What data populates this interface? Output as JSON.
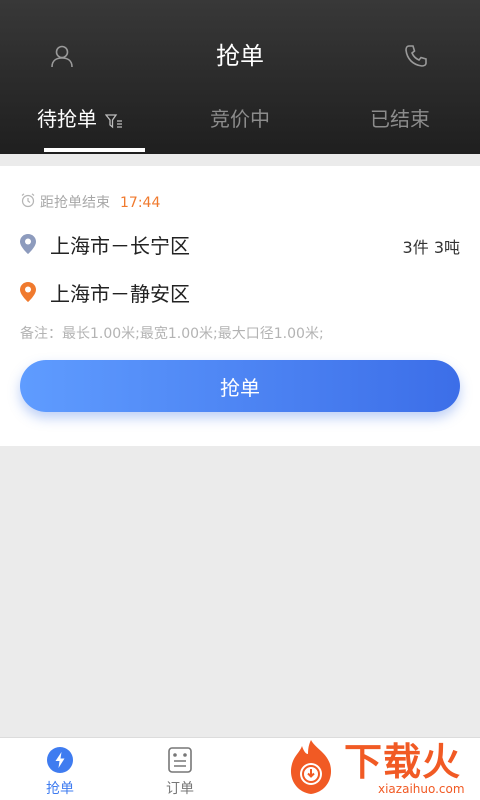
{
  "header": {
    "title": "抢单",
    "left_icon": "user-icon",
    "right_icon": "phone-icon"
  },
  "tabs": [
    {
      "label": "待抢单",
      "active": true,
      "icon": "filter-icon"
    },
    {
      "label": "竞价中",
      "active": false
    },
    {
      "label": "已结束",
      "active": false
    }
  ],
  "order": {
    "countdown_label": "距抢单结束",
    "countdown_time": "17:44",
    "from": "上海市－长宁区",
    "to": "上海市－静安区",
    "quantity": "3件 3吨",
    "remark": "备注：最长1.00米;最宽1.00米;最大口径1.00米;",
    "grab_button": "抢单"
  },
  "bottom_nav": [
    {
      "label": "抢单",
      "icon": "lightning-icon",
      "active": true
    },
    {
      "label": "订单",
      "icon": "order-list-icon",
      "active": false
    }
  ],
  "watermark": {
    "text": "下载火",
    "subtext": "xiazaihuo.com"
  },
  "colors": {
    "accent_blue": "#3f7cf0",
    "timer_orange": "#f07a2e",
    "header_dark": "#2a2a2a",
    "origin_pin": "#8d9bbd",
    "destination_pin": "#f07a2e"
  }
}
